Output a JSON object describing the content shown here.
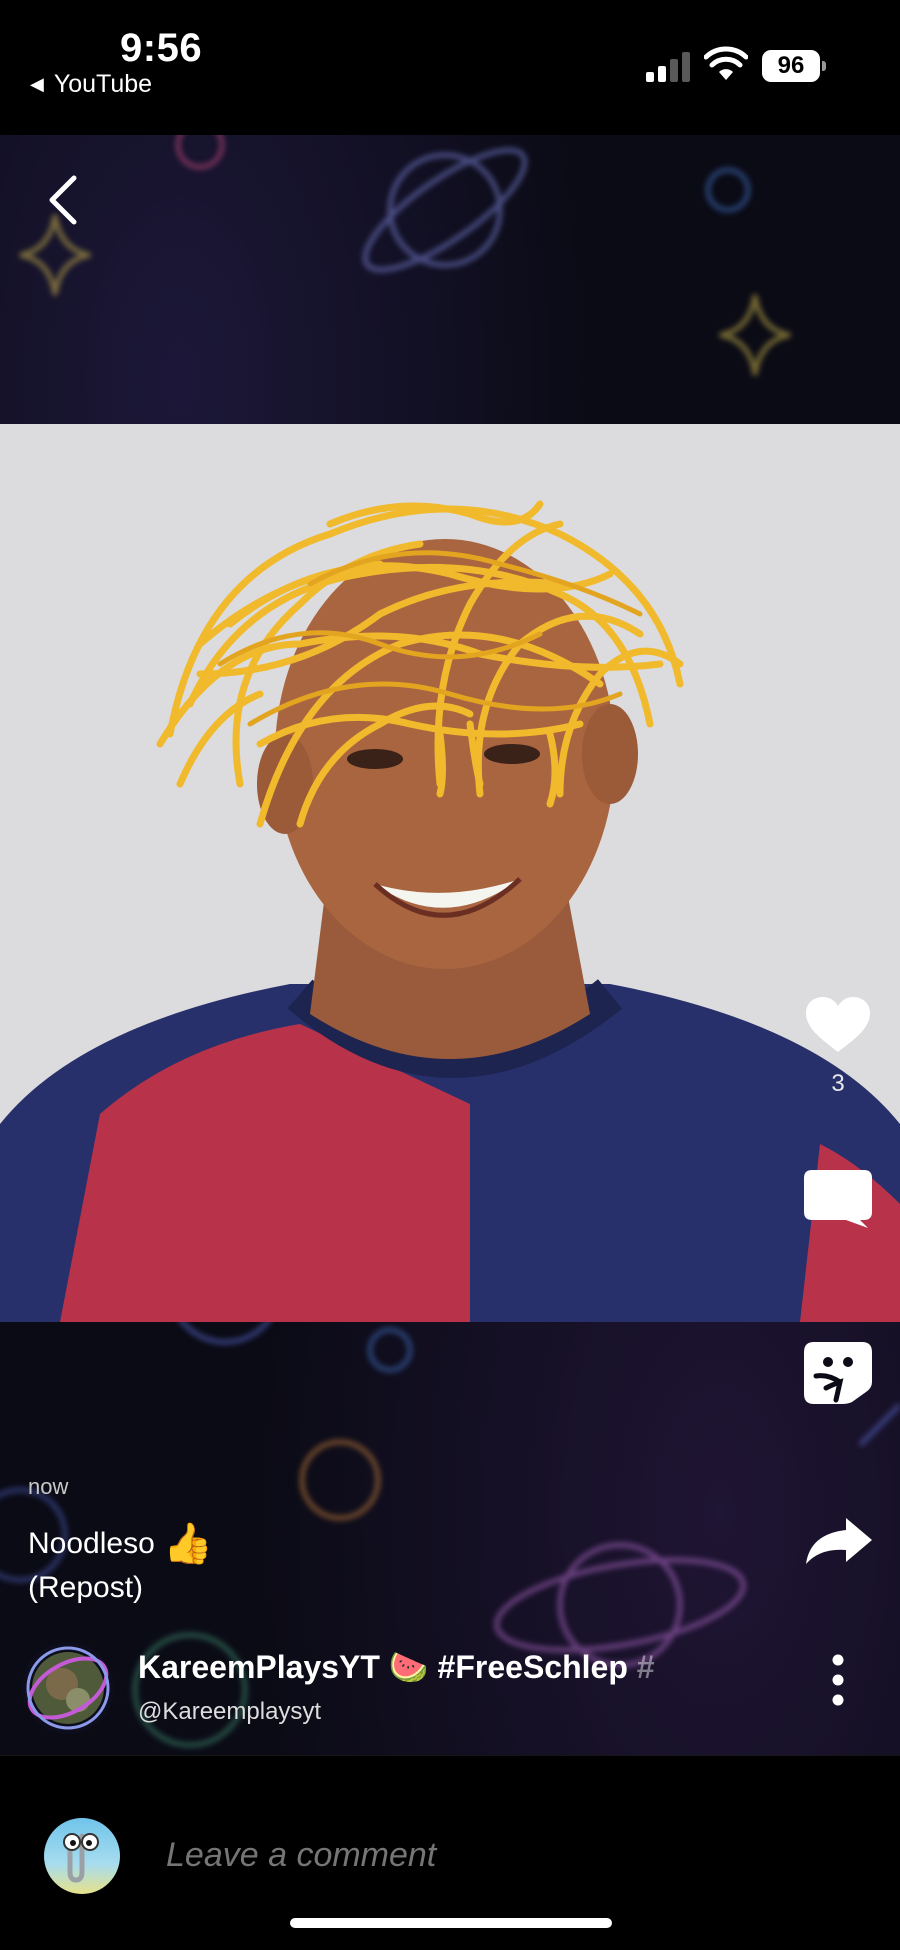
{
  "status_bar": {
    "time": "9:56",
    "back_app_label": "YouTube",
    "battery_level": "96"
  },
  "post": {
    "timestamp": "now",
    "caption_line1": "Noodleso",
    "caption_emoji": "👍",
    "caption_line2": "(Repost)",
    "like_count": "3"
  },
  "author": {
    "name": "KareemPlaysYT",
    "name_emoji": "🍉",
    "name_tag": "#FreeSchlep",
    "name_overflow": "#",
    "handle": "@Kareemplaysyt"
  },
  "comment": {
    "placeholder": "Leave a comment"
  },
  "icons": {
    "back": "chevron-left-icon",
    "like": "heart-icon",
    "comment": "speech-bubble-icon",
    "sticker": "sticker-icon",
    "share": "share-arrow-icon",
    "more": "vertical-dots-icon"
  }
}
